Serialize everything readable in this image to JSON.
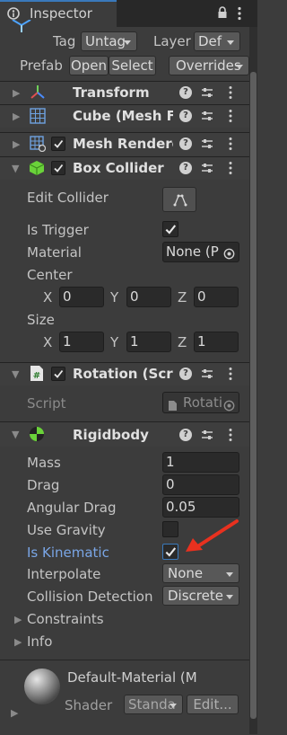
{
  "window": {
    "tab_title": "Inspector",
    "lock_icon": "lock-icon",
    "menu_icon": "kebab-menu-icon"
  },
  "header": {
    "tag_label": "Tag",
    "tag_value": "Untag",
    "layer_label": "Layer",
    "layer_value": "Def",
    "prefab_label": "Prefab",
    "open_label": "Open",
    "select_label": "Select",
    "overrides_label": "Overrides"
  },
  "components": {
    "transform": {
      "title": "Transform"
    },
    "cube_filter": {
      "title": "Cube (Mesh Fil"
    },
    "mesh_renderer": {
      "title": "Mesh Rendere",
      "enabled": true
    },
    "box_collider": {
      "title": "Box Collider",
      "enabled": true,
      "edit_collider_label": "Edit Collider",
      "is_trigger_label": "Is Trigger",
      "is_trigger": true,
      "material_label": "Material",
      "material_value": "None (P",
      "center_label": "Center",
      "center": {
        "x_label": "X",
        "x": "0",
        "y_label": "Y",
        "y": "0",
        "z_label": "Z",
        "z": "0"
      },
      "size_label": "Size",
      "size": {
        "x_label": "X",
        "x": "1",
        "y_label": "Y",
        "y": "1",
        "z_label": "Z",
        "z": "1"
      }
    },
    "rotation_script": {
      "title": "Rotation (Scrip",
      "enabled": true,
      "script_label": "Script",
      "script_value": "Rotati"
    },
    "rigidbody": {
      "title": "Rigidbody",
      "mass_label": "Mass",
      "mass": "1",
      "drag_label": "Drag",
      "drag": "0",
      "angular_drag_label": "Angular Drag",
      "angular_drag": "0.05",
      "use_gravity_label": "Use Gravity",
      "use_gravity": false,
      "is_kinematic_label": "Is Kinematic",
      "is_kinematic": true,
      "interpolate_label": "Interpolate",
      "interpolate_value": "None",
      "collision_detection_label": "Collision Detection",
      "collision_detection_value": "Discrete",
      "constraints_label": "Constraints",
      "info_label": "Info"
    }
  },
  "material": {
    "name": "Default-Material (M",
    "shader_label": "Shader",
    "shader_value": "Standa",
    "edit_label": "Edit..."
  },
  "annotation": {
    "arrow_color": "#e8311f"
  },
  "colors": {
    "accent": "#3a79bb",
    "highlight_label": "#7aa6e6"
  }
}
